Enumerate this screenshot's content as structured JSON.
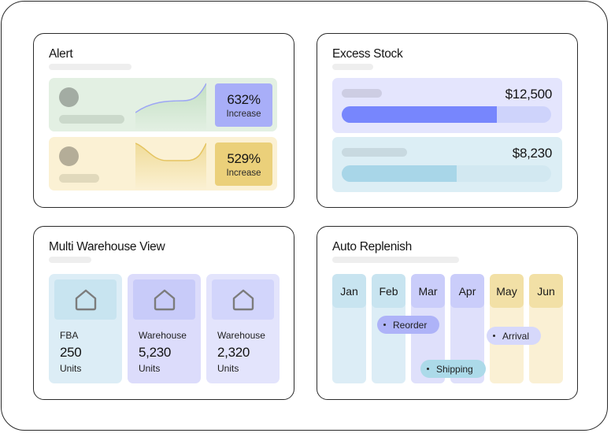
{
  "colors": {
    "green_bg": "#e3f0e3",
    "yellow_bg": "#fbf1d4",
    "purple_badge": "#a8aef8",
    "gold_badge": "#ebd07a",
    "excess_row1_bg": "#e4e5fd",
    "excess_row2_bg": "#dceef5",
    "bar1_fill": "#7786fd",
    "bar1_track": "#ced3fb",
    "bar2_fill": "#a8d6e8",
    "bar2_track": "#d2e8f1",
    "blue_col": "#dcedf6",
    "blue_head": "#c8e4f0",
    "purple_col": "#dfe0fb",
    "purple_head": "#cacdfa",
    "yellow_col": "#faf0d4",
    "yellow_head": "#f2e0a6"
  },
  "alert": {
    "title": "Alert",
    "rows": [
      {
        "value": "632%",
        "label": "Increase",
        "trend": "rising"
      },
      {
        "value": "529%",
        "label": "Increase",
        "trend": "dip"
      }
    ]
  },
  "excess": {
    "title": "Excess Stock",
    "rows": [
      {
        "value": "$12,500",
        "progress": 0.74
      },
      {
        "value": "$8,230",
        "progress": 0.55
      }
    ]
  },
  "warehouse": {
    "title": "Multi Warehouse View",
    "cards": [
      {
        "name": "FBA",
        "value": "250",
        "unit": "Units",
        "icon": "home-icon"
      },
      {
        "name": "Warehouse",
        "value": "5,230",
        "unit": "Units",
        "icon": "home-icon"
      },
      {
        "name": "Warehouse",
        "value": "2,320",
        "unit": "Units",
        "icon": "home-icon"
      }
    ]
  },
  "replenish": {
    "title": "Auto Replenish",
    "months": [
      "Jan",
      "Feb",
      "Mar",
      "Apr",
      "May",
      "Jun"
    ],
    "events": [
      {
        "label": "Reorder",
        "color": "#aeb3f8"
      },
      {
        "label": "Shipping",
        "color": "#acdae9"
      },
      {
        "label": "Arrival",
        "color": "#d6d8fb"
      }
    ]
  }
}
